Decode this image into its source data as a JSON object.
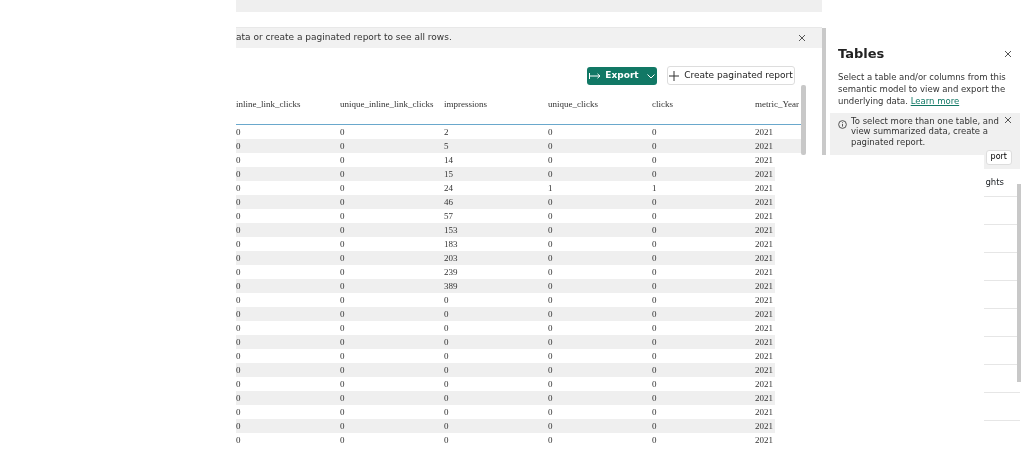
{
  "banner": {
    "text": "ata or create a paginated report to see all rows."
  },
  "toolbar": {
    "export_button": "Export",
    "create_button": "Create paginated report"
  },
  "table": {
    "columns": [
      "inline_link_clicks",
      "unique_inline_link_clicks",
      "impressions",
      "unique_clicks",
      "clicks",
      "metric_Year"
    ],
    "rows": [
      [
        "0",
        "0",
        "2",
        "0",
        "0",
        "2021"
      ],
      [
        "0",
        "0",
        "5",
        "0",
        "0",
        "2021"
      ],
      [
        "0",
        "0",
        "14",
        "0",
        "0",
        "2021"
      ],
      [
        "0",
        "0",
        "15",
        "0",
        "0",
        "2021"
      ],
      [
        "0",
        "0",
        "24",
        "1",
        "1",
        "2021"
      ],
      [
        "0",
        "0",
        "46",
        "0",
        "0",
        "2021"
      ],
      [
        "0",
        "0",
        "57",
        "0",
        "0",
        "2021"
      ],
      [
        "0",
        "0",
        "153",
        "0",
        "0",
        "2021"
      ],
      [
        "0",
        "0",
        "183",
        "0",
        "0",
        "2021"
      ],
      [
        "0",
        "0",
        "203",
        "0",
        "0",
        "2021"
      ],
      [
        "0",
        "0",
        "239",
        "0",
        "0",
        "2021"
      ],
      [
        "0",
        "0",
        "389",
        "0",
        "0",
        "2021"
      ],
      [
        "0",
        "0",
        "0",
        "0",
        "0",
        "2021"
      ],
      [
        "0",
        "0",
        "0",
        "0",
        "0",
        "2021"
      ],
      [
        "0",
        "0",
        "0",
        "0",
        "0",
        "2021"
      ],
      [
        "0",
        "0",
        "0",
        "0",
        "0",
        "2021"
      ],
      [
        "0",
        "0",
        "0",
        "0",
        "0",
        "2021"
      ],
      [
        "0",
        "0",
        "0",
        "0",
        "0",
        "2021"
      ],
      [
        "0",
        "0",
        "0",
        "0",
        "0",
        "2021"
      ],
      [
        "0",
        "0",
        "0",
        "0",
        "0",
        "2021"
      ],
      [
        "0",
        "0",
        "0",
        "0",
        "0",
        "2021"
      ],
      [
        "0",
        "0",
        "0",
        "0",
        "0",
        "2021"
      ],
      [
        "0",
        "0",
        "0",
        "0",
        "0",
        "2021"
      ]
    ]
  },
  "side_panel": {
    "title": "Tables",
    "description": "Select a table and/or columns from this semantic model to view and export the underlying data.",
    "link": "Learn more",
    "info": "To select more than one table, and view summarized data, create a paginated report.",
    "info_button": "port",
    "items": [
      {
        "label": "ghts"
      }
    ]
  }
}
